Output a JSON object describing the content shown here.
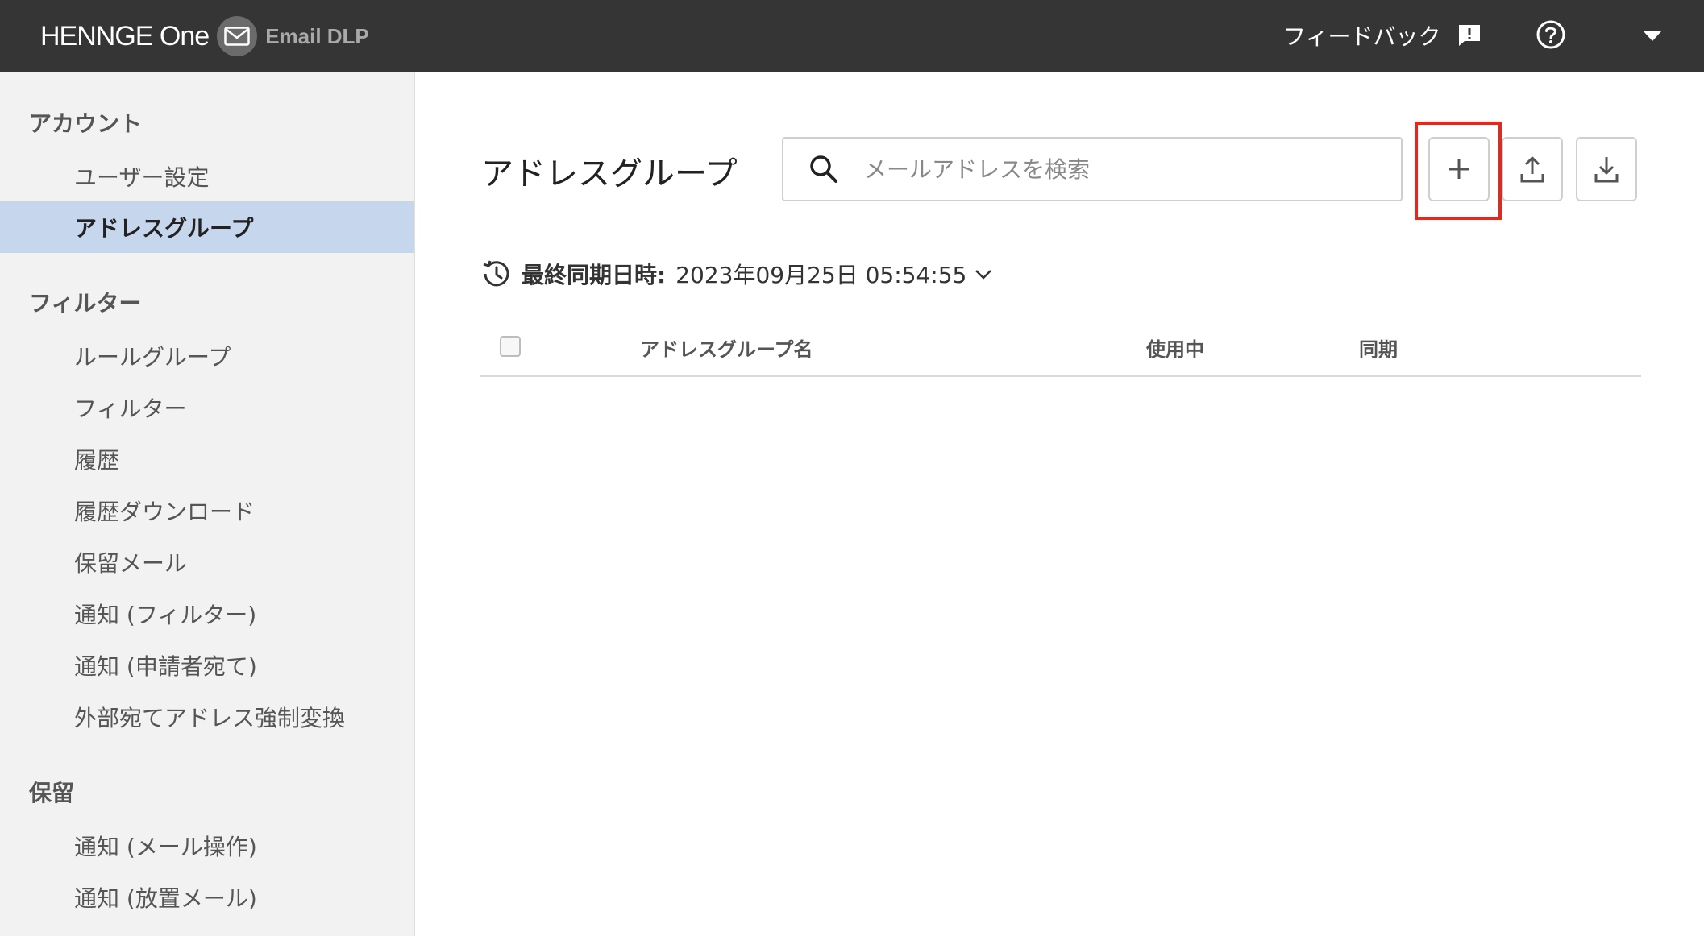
{
  "header": {
    "brand_name": "HENNGE One",
    "product_name": "Email DLP",
    "feedback_label": "フィードバック"
  },
  "sidebar": {
    "sections": [
      {
        "heading": "アカウント",
        "items": [
          {
            "label": "ユーザー設定",
            "active": false
          },
          {
            "label": "アドレスグループ",
            "active": true
          }
        ]
      },
      {
        "heading": "フィルター",
        "items": [
          {
            "label": "ルールグループ",
            "active": false
          },
          {
            "label": "フィルター",
            "active": false
          },
          {
            "label": "履歴",
            "active": false
          },
          {
            "label": "履歴ダウンロード",
            "active": false
          },
          {
            "label": "保留メール",
            "active": false
          },
          {
            "label": "通知 (フィルター)",
            "active": false
          },
          {
            "label": "通知 (申請者宛て)",
            "active": false
          },
          {
            "label": "外部宛てアドレス強制変換",
            "active": false
          }
        ]
      },
      {
        "heading": "保留",
        "items": [
          {
            "label": "通知 (メール操作)",
            "active": false
          },
          {
            "label": "通知 (放置メール)",
            "active": false
          }
        ]
      }
    ]
  },
  "main": {
    "title": "アドレスグループ",
    "search": {
      "placeholder": "メールアドレスを検索",
      "value": ""
    },
    "toolbar": {
      "add_icon": "plus-icon",
      "upload_icon": "upload-icon",
      "download_icon": "download-icon",
      "highlight_color": "#e8261b"
    },
    "sync": {
      "label": "最終同期日時:",
      "value": "2023年09月25日 05:54:55"
    },
    "table": {
      "columns": [
        "アドレスグループ名",
        "使用中",
        "同期"
      ],
      "rows": []
    }
  },
  "colors": {
    "topbar": "#353535",
    "sidebar_bg": "#f2f2f2",
    "active_item_bg": "#c6d6ec"
  }
}
